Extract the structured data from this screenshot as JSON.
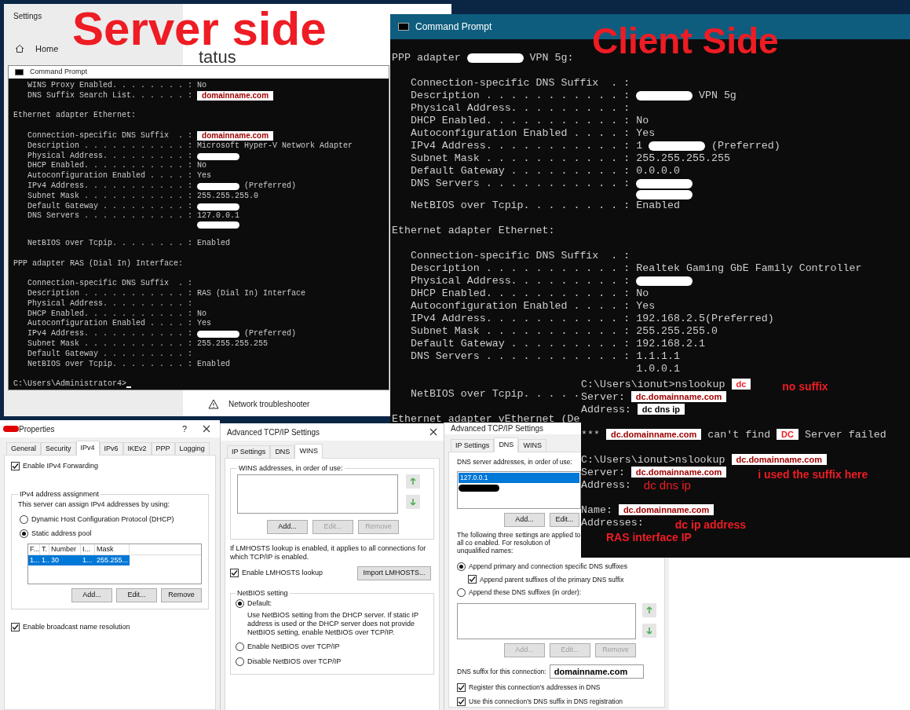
{
  "settings_window": {
    "title": "Settings",
    "home": "Home",
    "heading": "tatus",
    "troubleshooter": "Network troubleshooter"
  },
  "annotations": {
    "server": "Server side",
    "client": "Client Side"
  },
  "server_cmd": {
    "title": "Command Prompt",
    "lines": [
      {
        "kind": "field",
        "label": "WINS Proxy Enabled. . . . . . . . :",
        "parts": [
          {
            "kind": "text",
            "text": "No"
          }
        ]
      },
      {
        "kind": "field",
        "label": "DNS Suffix Search List. . . . . . :",
        "parts": [
          {
            "kind": "boxed",
            "text": "domainname.com",
            "color": "#a00000"
          }
        ]
      },
      {
        "kind": "blank"
      },
      {
        "kind": "heading",
        "parts": [
          {
            "kind": "text",
            "text": "Ethernet adapter Ethernet:"
          }
        ]
      },
      {
        "kind": "blank"
      },
      {
        "kind": "field",
        "label": "Connection-specific DNS Suffix  . :",
        "parts": [
          {
            "kind": "boxed",
            "text": "domainname.com",
            "color": "#a00000"
          }
        ]
      },
      {
        "kind": "field",
        "label": "Description . . . . . . . . . . . :",
        "parts": [
          {
            "kind": "text",
            "text": "Microsoft Hyper-V Network Adapter"
          }
        ]
      },
      {
        "kind": "field",
        "label": "Physical Address. . . . . . . . . :",
        "parts": [
          {
            "kind": "redaction"
          }
        ]
      },
      {
        "kind": "field",
        "label": "DHCP Enabled. . . . . . . . . . . :",
        "parts": [
          {
            "kind": "text",
            "text": "No"
          }
        ]
      },
      {
        "kind": "field",
        "label": "Autoconfiguration Enabled . . . . :",
        "parts": [
          {
            "kind": "text",
            "text": "Yes"
          }
        ]
      },
      {
        "kind": "field",
        "label": "IPv4 Address. . . . . . . . . . . :",
        "parts": [
          {
            "kind": "redaction"
          },
          {
            "kind": "text",
            "text": "(Preferred)"
          }
        ]
      },
      {
        "kind": "field",
        "label": "Subnet Mask . . . . . . . . . . . :",
        "parts": [
          {
            "kind": "text",
            "text": "255.255.255.0"
          }
        ]
      },
      {
        "kind": "field",
        "label": "Default Gateway . . . . . . . . . :",
        "parts": [
          {
            "kind": "redaction"
          }
        ]
      },
      {
        "kind": "field",
        "label": "DNS Servers . . . . . . . . . . . :",
        "parts": [
          {
            "kind": "text",
            "text": "127.0.0.1"
          }
        ]
      },
      {
        "kind": "continuation",
        "parts": [
          {
            "kind": "redaction"
          }
        ]
      },
      {
        "kind": "blank"
      },
      {
        "kind": "field",
        "label": "NetBIOS over Tcpip. . . . . . . . :",
        "parts": [
          {
            "kind": "text",
            "text": "Enabled"
          }
        ]
      },
      {
        "kind": "blank"
      },
      {
        "kind": "heading",
        "parts": [
          {
            "kind": "text",
            "text": "PPP adapter RAS (Dial In) Interface:"
          }
        ]
      },
      {
        "kind": "blank"
      },
      {
        "kind": "field",
        "label": "Connection-specific DNS Suffix  . :"
      },
      {
        "kind": "field",
        "label": "Description . . . . . . . . . . . :",
        "parts": [
          {
            "kind": "text",
            "text": "RAS (Dial In) Interface"
          }
        ]
      },
      {
        "kind": "field",
        "label": "Physical Address. . . . . . . . . :"
      },
      {
        "kind": "field",
        "label": "DHCP Enabled. . . . . . . . . . . :",
        "parts": [
          {
            "kind": "text",
            "text": "No"
          }
        ]
      },
      {
        "kind": "field",
        "label": "Autoconfiguration Enabled . . . . :",
        "parts": [
          {
            "kind": "text",
            "text": "Yes"
          }
        ]
      },
      {
        "kind": "field",
        "label": "IPv4 Address. . . . . . . . . . . :",
        "parts": [
          {
            "kind": "redaction"
          },
          {
            "kind": "text",
            "text": "(Preferred)"
          }
        ]
      },
      {
        "kind": "field",
        "label": "Subnet Mask . . . . . . . . . . . :",
        "parts": [
          {
            "kind": "text",
            "text": "255.255.255.255"
          }
        ]
      },
      {
        "kind": "field",
        "label": "Default Gateway . . . . . . . . . :"
      },
      {
        "kind": "field",
        "label": "NetBIOS over Tcpip. . . . . . . . :",
        "parts": [
          {
            "kind": "text",
            "text": "Enabled"
          }
        ]
      },
      {
        "kind": "blank"
      },
      {
        "kind": "prompt",
        "parts": [
          {
            "kind": "text",
            "text": "C:\\Users\\Administrator4>"
          }
        ]
      }
    ]
  },
  "client_cmd": {
    "title": "Command Prompt",
    "lines": [
      {
        "kind": "blank"
      },
      {
        "kind": "heading",
        "parts": [
          {
            "kind": "text",
            "text": "PPP adapter"
          },
          {
            "kind": "redaction"
          },
          {
            "kind": "text",
            "text": "VPN 5g:"
          }
        ]
      },
      {
        "kind": "blank"
      },
      {
        "kind": "field",
        "label": "Connection-specific DNS Suffix  . :"
      },
      {
        "kind": "field",
        "label": "Description . . . . . . . . . . . :",
        "parts": [
          {
            "kind": "redaction"
          },
          {
            "kind": "text",
            "text": "VPN 5g"
          }
        ]
      },
      {
        "kind": "field",
        "label": "Physical Address. . . . . . . . . :"
      },
      {
        "kind": "field",
        "label": "DHCP Enabled. . . . . . . . . . . :",
        "parts": [
          {
            "kind": "text",
            "text": "No"
          }
        ]
      },
      {
        "kind": "field",
        "label": "Autoconfiguration Enabled . . . . :",
        "parts": [
          {
            "kind": "text",
            "text": "Yes"
          }
        ]
      },
      {
        "kind": "field",
        "label": "IPv4 Address. . . . . . . . . . . :",
        "parts": [
          {
            "kind": "text",
            "text": "1"
          },
          {
            "kind": "redaction"
          },
          {
            "kind": "text",
            "text": "(Preferred)"
          }
        ]
      },
      {
        "kind": "field",
        "label": "Subnet Mask . . . . . . . . . . . :",
        "parts": [
          {
            "kind": "text",
            "text": "255.255.255.255"
          }
        ]
      },
      {
        "kind": "field",
        "label": "Default Gateway . . . . . . . . . :",
        "parts": [
          {
            "kind": "text",
            "text": "0.0.0.0"
          }
        ]
      },
      {
        "kind": "field",
        "label": "DNS Servers . . . . . . . . . . . :",
        "parts": [
          {
            "kind": "redaction"
          }
        ]
      },
      {
        "kind": "continuation",
        "parts": [
          {
            "kind": "redaction"
          }
        ]
      },
      {
        "kind": "field",
        "label": "NetBIOS over Tcpip. . . . . . . . :",
        "parts": [
          {
            "kind": "text",
            "text": "Enabled"
          }
        ]
      },
      {
        "kind": "blank"
      },
      {
        "kind": "heading",
        "parts": [
          {
            "kind": "text",
            "text": "Ethernet adapter Ethernet:"
          }
        ]
      },
      {
        "kind": "blank"
      },
      {
        "kind": "field",
        "label": "Connection-specific DNS Suffix  . :"
      },
      {
        "kind": "field",
        "label": "Description . . . . . . . . . . . :",
        "parts": [
          {
            "kind": "text",
            "text": "Realtek Gaming GbE Family Controller"
          }
        ]
      },
      {
        "kind": "field",
        "label": "Physical Address. . . . . . . . . :",
        "parts": [
          {
            "kind": "redaction"
          }
        ]
      },
      {
        "kind": "field",
        "label": "DHCP Enabled. . . . . . . . . . . :",
        "parts": [
          {
            "kind": "text",
            "text": "No"
          }
        ]
      },
      {
        "kind": "field",
        "label": "Autoconfiguration Enabled . . . . :",
        "parts": [
          {
            "kind": "text",
            "text": "Yes"
          }
        ]
      },
      {
        "kind": "field",
        "label": "IPv4 Address. . . . . . . . . . . :",
        "parts": [
          {
            "kind": "text",
            "text": "192.168.2.5(Preferred)"
          }
        ]
      },
      {
        "kind": "field",
        "label": "Subnet Mask . . . . . . . . . . . :",
        "parts": [
          {
            "kind": "text",
            "text": "255.255.255.0"
          }
        ]
      },
      {
        "kind": "field",
        "label": "Default Gateway . . . . . . . . . :",
        "parts": [
          {
            "kind": "text",
            "text": "192.168.2.1"
          }
        ]
      },
      {
        "kind": "field",
        "label": "DNS Servers . . . . . . . . . . . :",
        "parts": [
          {
            "kind": "text",
            "text": "1.1.1.1"
          }
        ]
      },
      {
        "kind": "continuation",
        "parts": [
          {
            "kind": "text",
            "text": "1.0.0.1"
          }
        ]
      },
      {
        "kind": "blank"
      },
      {
        "kind": "field",
        "label": "NetBIOS over Tcpip. . . . ."
      },
      {
        "kind": "blank"
      },
      {
        "kind": "heading",
        "parts": [
          {
            "kind": "text",
            "text": "Ethernet adapter vEthernet (De"
          }
        ]
      }
    ]
  },
  "nslookup": {
    "lines": [
      {
        "kind": "line",
        "parts": [
          {
            "kind": "text",
            "text": "C:\\Users\\ionut>nslookup"
          },
          {
            "kind": "boxed",
            "text": "dc",
            "color": "#ee1c24"
          },
          {
            "kind": "note",
            "text": "no suffix"
          }
        ]
      },
      {
        "kind": "line",
        "parts": [
          {
            "kind": "text",
            "text": "Server:"
          },
          {
            "kind": "boxed",
            "text": "dc.domainname.com",
            "color": "#a00000"
          }
        ]
      },
      {
        "kind": "line",
        "parts": [
          {
            "kind": "text",
            "text": "Address:"
          },
          {
            "kind": "boxed",
            "text": "dc dns ip",
            "color": "#000000"
          }
        ]
      },
      {
        "kind": "blank"
      },
      {
        "kind": "line",
        "parts": [
          {
            "kind": "text",
            "text": "***"
          },
          {
            "kind": "boxed",
            "text": "dc.domainname.com",
            "color": "#a00000"
          },
          {
            "kind": "text",
            "text": "can't find"
          },
          {
            "kind": "boxed",
            "text": "DC",
            "color": "#ee1c24"
          },
          {
            "kind": "text",
            "text": "Server failed"
          }
        ]
      },
      {
        "kind": "blank"
      },
      {
        "kind": "line",
        "parts": [
          {
            "kind": "text",
            "text": "C:\\Users\\ionut>nslookup"
          },
          {
            "kind": "boxed",
            "text": "dc.domainname.com",
            "color": "#a00000"
          }
        ]
      },
      {
        "kind": "line",
        "parts": [
          {
            "kind": "text",
            "text": "Server:"
          },
          {
            "kind": "boxed",
            "text": "dc.domainname.com",
            "color": "#a00000"
          },
          {
            "kind": "note",
            "text": "i used the suffix here"
          }
        ]
      },
      {
        "kind": "line",
        "parts": [
          {
            "kind": "text",
            "text": "Address:"
          },
          {
            "kind": "plain_note",
            "text": "dc dns ip"
          }
        ]
      },
      {
        "kind": "blank"
      },
      {
        "kind": "line",
        "parts": [
          {
            "kind": "text",
            "text": "Name:"
          },
          {
            "kind": "boxed",
            "text": "dc.domainname.com",
            "color": "#a00000"
          }
        ]
      },
      {
        "kind": "line",
        "parts": [
          {
            "kind": "text",
            "text": "Addresses:"
          },
          {
            "kind": "note",
            "text": "dc ip address"
          }
        ]
      },
      {
        "kind": "line",
        "parts": [
          {
            "kind": "note",
            "text": "RAS interface IP"
          }
        ]
      }
    ]
  },
  "properties_dialog": {
    "title": "Properties",
    "help": "?",
    "tabs": [
      {
        "label": "General",
        "selected": false
      },
      {
        "label": "Security",
        "selected": false
      },
      {
        "label": "IPv4",
        "selected": true
      },
      {
        "label": "IPv6",
        "selected": false
      },
      {
        "label": "IKEv2",
        "selected": false
      },
      {
        "label": "PPP",
        "selected": false
      },
      {
        "label": "Logging",
        "selected": false
      }
    ],
    "forwarding": {
      "label": "Enable IPv4 Forwarding",
      "checked": true
    },
    "assignment": {
      "title": "IPv4 address assignment",
      "intro": "This server can assign IPv4 addresses by using:",
      "options": [
        {
          "label": "Dynamic Host Configuration Protocol (DHCP)",
          "selected": false
        },
        {
          "label": "Static address pool",
          "selected": true
        }
      ],
      "table": {
        "columns": [
          "F...",
          "T.",
          "Number",
          "I...",
          "Mask"
        ],
        "rows": [
          {
            "cells": [
              "1...",
              "1..",
              "30",
              "1...",
              "255.255..."
            ],
            "selected": true
          }
        ]
      },
      "buttons": [
        {
          "label": "Add...",
          "disabled": false
        },
        {
          "label": "Edit...",
          "disabled": false
        },
        {
          "label": "Remove",
          "disabled": false
        }
      ]
    },
    "broadcast": {
      "label": "Enable broadcast name resolution",
      "checked": true
    }
  },
  "wins_dialog": {
    "title": "Advanced TCP/IP Settings",
    "tabs": [
      {
        "label": "IP Settings",
        "selected": false
      },
      {
        "label": "DNS",
        "selected": false
      },
      {
        "label": "WINS",
        "selected": true
      }
    ],
    "group_title": "WINS addresses, in order of use:",
    "buttons": [
      {
        "label": "Add...",
        "disabled": false
      },
      {
        "label": "Edit...",
        "disabled": true
      },
      {
        "label": "Remove",
        "disabled": true
      }
    ],
    "lmhosts_note": "If LMHOSTS lookup is enabled, it applies to all connections for which TCP/IP is enabled.",
    "lmhosts": {
      "label": "Enable LMHOSTS lookup",
      "checked": true
    },
    "import_button": "Import LMHOSTS...",
    "netbios": {
      "title": "NetBIOS setting",
      "options": [
        {
          "label": "Default:",
          "selected": true,
          "description": "Use NetBIOS setting from the DHCP server. If static IP address is used or the DHCP server does not provide NetBIOS setting, enable NetBIOS over TCP/IP."
        },
        {
          "label": "Enable NetBIOS over TCP/IP",
          "selected": false
        },
        {
          "label": "Disable NetBIOS over TCP/IP",
          "selected": false
        }
      ]
    }
  },
  "dns_dialog": {
    "title": "Advanced TCP/IP Settings",
    "tabs": [
      {
        "label": "IP Settings",
        "selected": false
      },
      {
        "label": "DNS",
        "selected": true
      },
      {
        "label": "WINS",
        "selected": false
      }
    ],
    "servers_label": "DNS server addresses, in order of use:",
    "servers": [
      {
        "kind": "text",
        "text": "127.0.0.1",
        "selected": true
      },
      {
        "kind": "redaction",
        "selected": false
      }
    ],
    "server_buttons": [
      {
        "label": "Add...",
        "disabled": false
      },
      {
        "label": "Edit...",
        "disabled": false
      }
    ],
    "note": "The following three settings are applied to all co enabled. For resolution of unqualified names:",
    "options": [
      {
        "kind": "radio",
        "label": "Append primary and connection specific DNS suffixes",
        "selected": true
      },
      {
        "kind": "checkbox",
        "label": "Append parent suffixes of the primary DNS suffix",
        "selected": true
      },
      {
        "kind": "radio",
        "label": "Append these DNS suffixes (in order):",
        "selected": false
      }
    ],
    "suffix_buttons": [
      {
        "label": "Add...",
        "disabled": true
      },
      {
        "label": "Edit...",
        "disabled": true
      },
      {
        "label": "Remove",
        "disabled": true
      }
    ],
    "suffix_label": "DNS suffix for this connection:",
    "suffix_value": "domainname.com",
    "checks": [
      {
        "label": "Register this connection's addresses in DNS",
        "checked": true
      },
      {
        "label": "Use this connection's DNS suffix in DNS registration",
        "checked": true
      }
    ]
  }
}
